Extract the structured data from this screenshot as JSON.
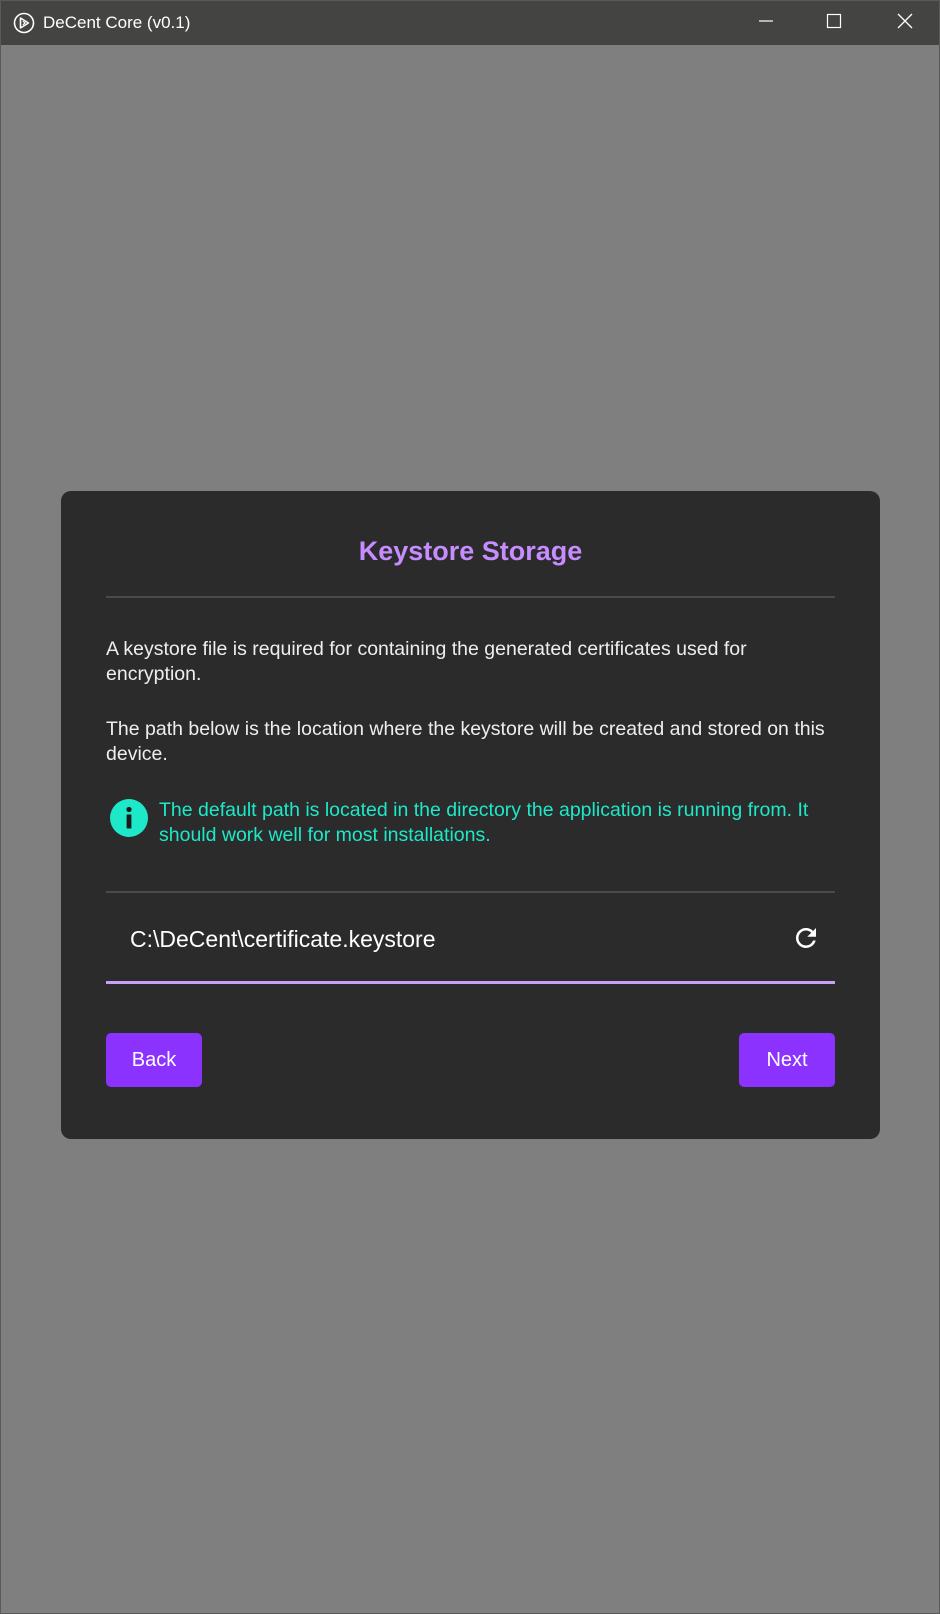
{
  "window": {
    "title": "DeCent Core (v0.1)"
  },
  "dialog": {
    "title": "Keystore Storage",
    "paragraph_1": "A keystore file is required for containing the generated certificates used for encryption.",
    "paragraph_2": "The path below is the location where the keystore will be created and stored on this device.",
    "info_text": "The default path is located in the directory the application is running from. It should work well for most installations.",
    "keystore_path": "C:\\DeCent\\certificate.keystore",
    "back_label": "Back",
    "next_label": "Next"
  },
  "icons": {
    "app": "decent-logo-icon",
    "minimize": "minimize-icon",
    "maximize": "maximize-icon",
    "close": "close-icon",
    "info": "info-icon",
    "refresh": "refresh-icon"
  },
  "colors": {
    "accent": "#8b32ff",
    "title": "#c78cff",
    "info": "#1de9c9",
    "field_underline": "#c8a0f6",
    "card": "#2b2b2b",
    "backdrop": "#7f7f7f",
    "titlebar": "#444442"
  }
}
